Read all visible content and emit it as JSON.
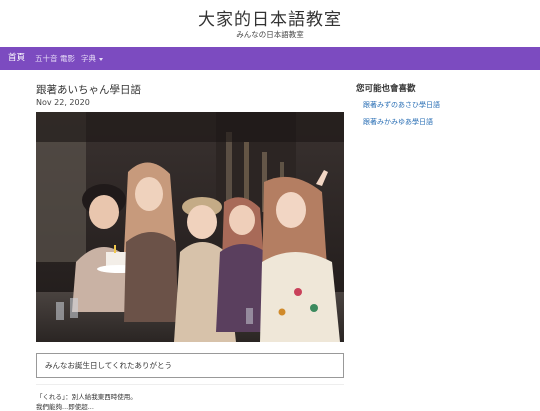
{
  "site": {
    "title": "大家的日本語教室",
    "subtitle": "みんなの日本語教室"
  },
  "nav": {
    "items": [
      "首頁",
      "五十音",
      "電影",
      "字典"
    ],
    "accent_color": "#7c4bc0"
  },
  "post": {
    "title": "跟著あいちゃん學日語",
    "date": "Nov 22, 2020",
    "image_alt": "group-photo-five-women-birthday-restaurant",
    "caption": "みんなお誕生日してくれたありがとう",
    "note_line1": "「くれる」：別人給我東西時使用。",
    "note_line2": "我們能夠...即使超..."
  },
  "sidebar": {
    "heading": "您可能也會喜歡",
    "links": [
      "跟著みずのあさひ學日語",
      "跟著みかみゆあ學日語"
    ],
    "link_color": "#2a6fb5"
  }
}
